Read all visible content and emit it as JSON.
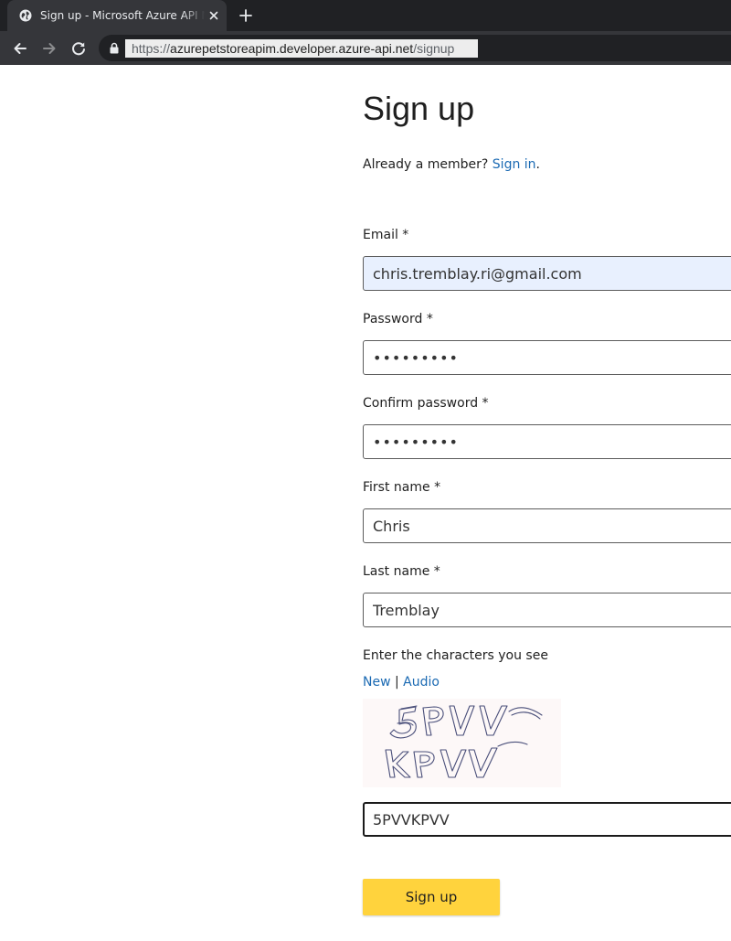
{
  "browser": {
    "tab_title": "Sign up - Microsoft Azure API Management",
    "url_prefix": "https://",
    "url_domain": "azurepetstoreapim.developer.azure-api.net",
    "url_path": "/signup"
  },
  "page": {
    "title": "Sign up",
    "already_member": "Already a member?",
    "sign_in_link": "Sign in",
    "period": "."
  },
  "form": {
    "email": {
      "label": "Email *",
      "value": "chris.tremblay.ri@gmail.com"
    },
    "password": {
      "label": "Password *",
      "value": "•••••••••"
    },
    "confirm_password": {
      "label": "Confirm password *",
      "value": "•••••••••"
    },
    "first_name": {
      "label": "First name *",
      "value": "Chris"
    },
    "last_name": {
      "label": "Last name *",
      "value": "Tremblay"
    },
    "captcha": {
      "label": "Enter the characters you see",
      "new_link": "New",
      "separator": " | ",
      "audio_link": "Audio",
      "image_text": "5PVVKPVV",
      "value": "5PVVKPVV"
    },
    "submit_label": "Sign up"
  },
  "colors": {
    "accent_button": "#ffd33d",
    "link": "#1b6ab3",
    "autofill_bg": "#e8f0fe"
  }
}
